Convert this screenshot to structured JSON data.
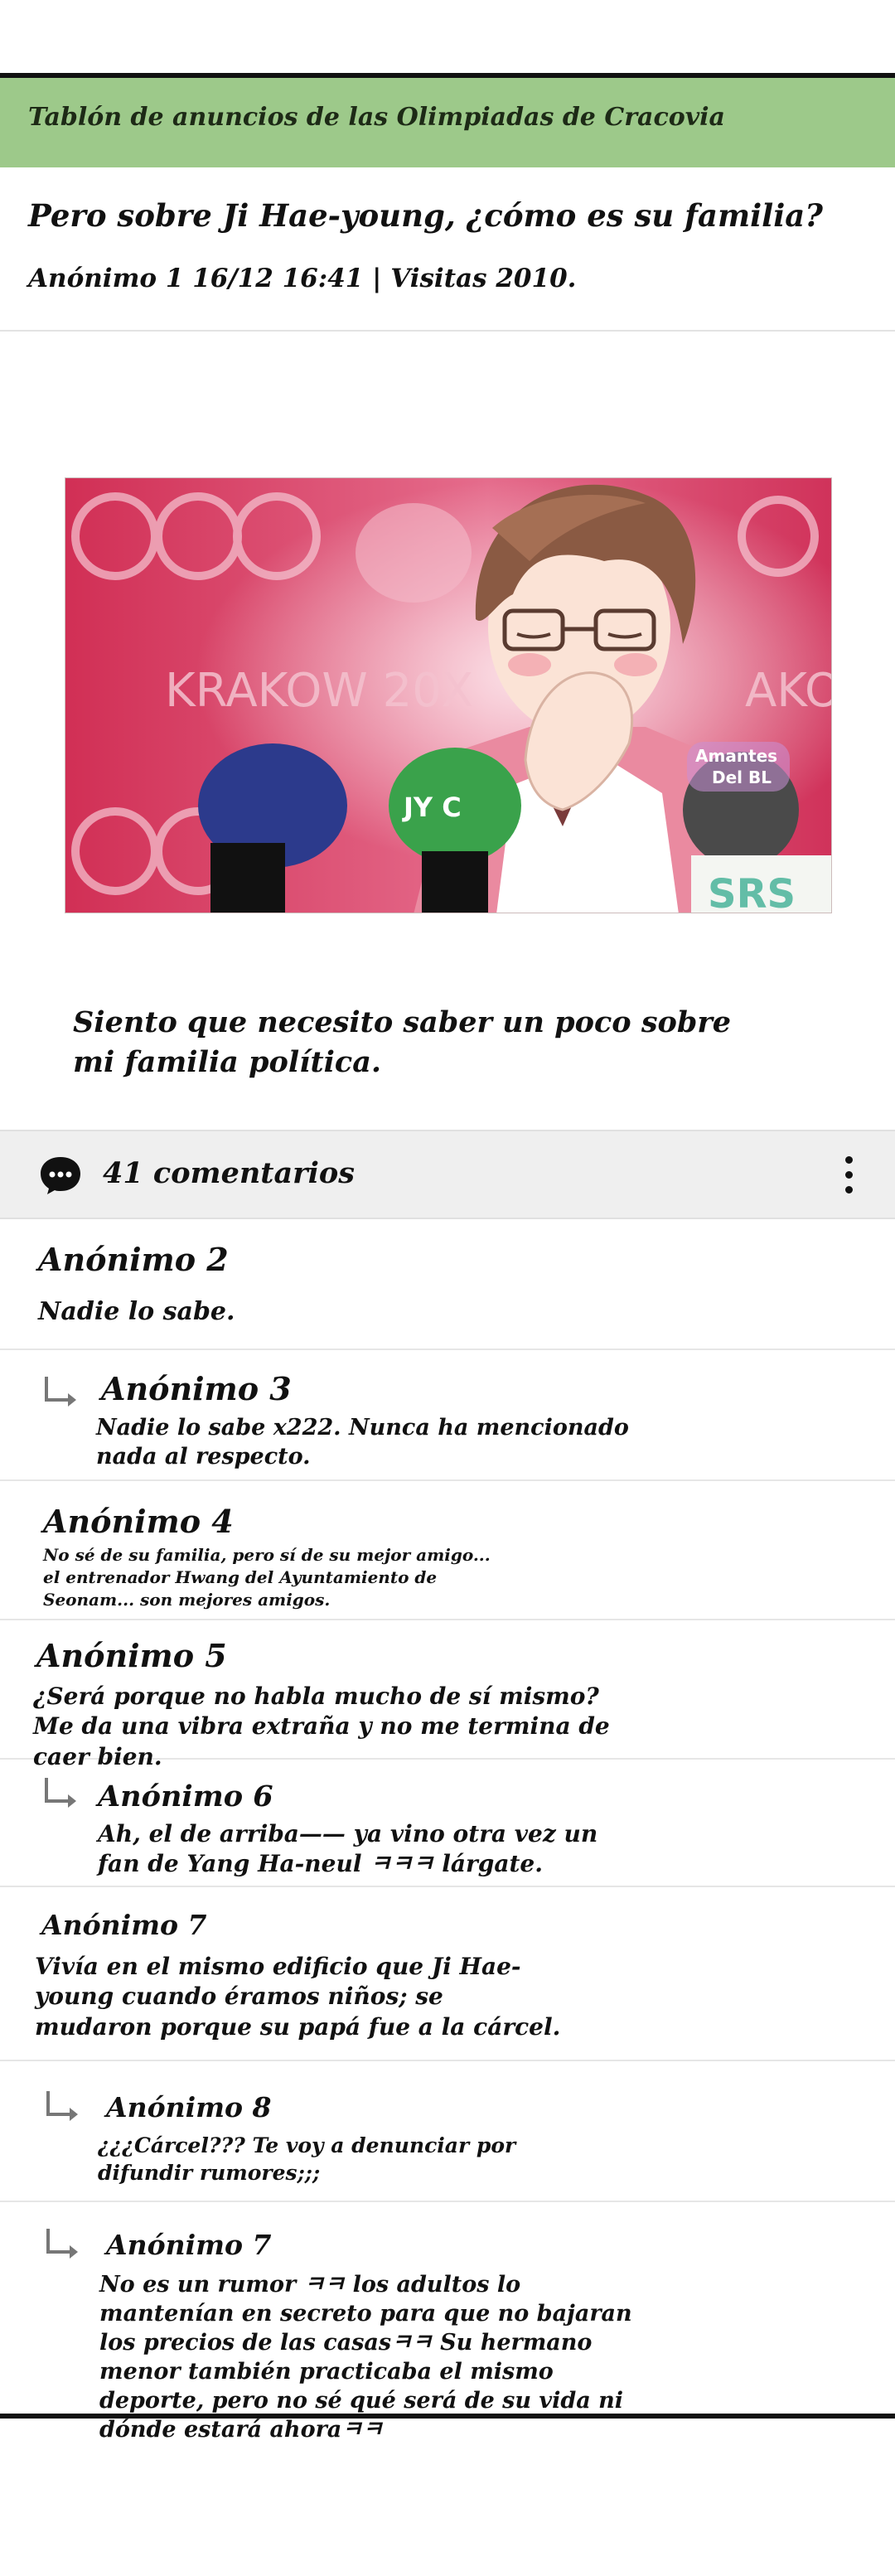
{
  "board": {
    "title": "Tablón de anuncios de las Olimpiadas de Cracovia"
  },
  "post": {
    "title": "Pero sobre Ji Hae-young, ¿cómo es su familia?",
    "meta": "Anónimo 1 16/12 16:41 | Visitas 2010.",
    "body": "Siento que necesito saber un poco sobre mi familia política.",
    "image": {
      "banner_text": "KRAKOW 20X",
      "banner_text_right": "AKO",
      "mic_label": "JY C",
      "srs_label": "SRS",
      "watermark_line1": "Amantes",
      "watermark_line2": "Del BL"
    }
  },
  "comments_bar": {
    "count_label": "41 comentarios",
    "icon": "speech-bubble-icon",
    "more_icon": "more-vertical-icon"
  },
  "comments": [
    {
      "author": "Anónimo 2",
      "text": "Nadie lo sabe.",
      "reply": false
    },
    {
      "author": "Anónimo 3",
      "text": "Nadie lo sabe x222. Nunca ha mencionado nada al respecto.",
      "reply": true
    },
    {
      "author": "Anónimo 4",
      "text": "No sé de su familia, pero sí de su mejor amigo... el entrenador Hwang del Ayuntamiento de Seonam... son mejores amigos.",
      "reply": false
    },
    {
      "author": "Anónimo 5",
      "text": "¿Será porque no habla mucho de sí mismo? Me da una vibra extraña y no me termina de caer bien.",
      "reply": false
    },
    {
      "author": "Anónimo 6",
      "text": "Ah, el de arriba—— ya vino otra vez un fan de Yang Ha-neul ㅋㅋㅋ lárgate.",
      "reply": true
    },
    {
      "author": "Anónimo 7",
      "text": "Vivía en el mismo edificio que Ji Hae-young cuando éramos niños; se mudaron porque su papá fue a la cárcel.",
      "reply": false
    },
    {
      "author": "Anónimo 8",
      "text": "¿¿¿Cárcel??? Te voy a denunciar por difundir rumores;;;",
      "reply": true
    },
    {
      "author": "Anónimo 7",
      "text": "No es un rumor ㅋㅋ los adultos lo mantenían en secreto para que no bajaran los precios de las casasㅋㅋ Su hermano menor también practicaba el mismo deporte, pero no sé qué será de su vida ni dónde estará ahoraㅋㅋ",
      "reply": true
    }
  ],
  "colors": {
    "header_bg": "#9dc98a",
    "bar_bg": "#efefef",
    "divider": "#e6e6e6"
  }
}
